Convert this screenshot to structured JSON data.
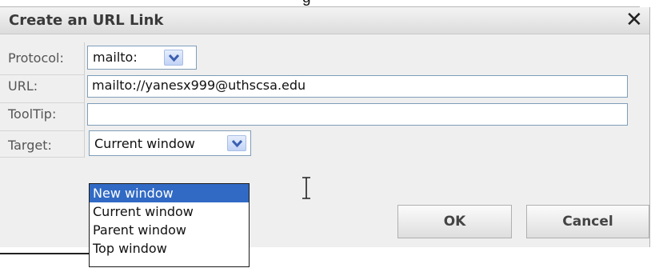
{
  "top_fragment": "g",
  "dialog": {
    "title": "Create an URL Link",
    "close_glyph": "✕"
  },
  "protocol": {
    "label": "Protocol:",
    "value": "mailto:"
  },
  "url": {
    "label": "URL:",
    "value": "mailto://yanesx999@uthscsa.edu"
  },
  "tooltip": {
    "label": "ToolTip:",
    "value": ""
  },
  "target": {
    "label": "Target:",
    "value": "Current window",
    "options": [
      "New window",
      "Current window",
      "Parent window",
      "Top window"
    ],
    "highlighted": "New window"
  },
  "buttons": {
    "ok": "OK",
    "cancel": "Cancel"
  },
  "colors": {
    "highlight": "#316ac5",
    "field_border": "#7f9db9",
    "dialog_bg": "#efefef"
  },
  "icons": {
    "dropdown": "chevron-down-icon",
    "close": "close-icon",
    "cursor": "text-cursor-icon"
  }
}
